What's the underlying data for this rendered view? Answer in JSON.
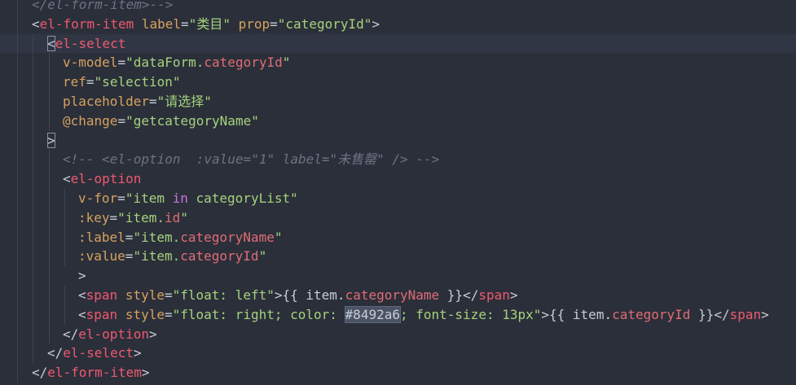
{
  "editor": {
    "lines": [
      {
        "indent": 1,
        "guides": [
          1
        ],
        "tokens": [
          {
            "t": "comment",
            "v": "</el-form-item>-->"
          }
        ]
      },
      {
        "indent": 1,
        "guides": [
          1
        ],
        "tokens": [
          {
            "t": "punct",
            "v": "<"
          },
          {
            "t": "tag",
            "v": "el-form-item"
          },
          {
            "t": "text",
            "v": " "
          },
          {
            "t": "attr",
            "v": "label"
          },
          {
            "t": "punct",
            "v": "="
          },
          {
            "t": "str",
            "v": "\"类目\""
          },
          {
            "t": "text",
            "v": " "
          },
          {
            "t": "attr",
            "v": "prop"
          },
          {
            "t": "punct",
            "v": "="
          },
          {
            "t": "str",
            "v": "\"categoryId\""
          },
          {
            "t": "punct",
            "v": ">"
          }
        ]
      },
      {
        "indent": 2,
        "guides": [
          1,
          2
        ],
        "active": true,
        "tokens": [
          {
            "t": "punct box",
            "v": "<"
          },
          {
            "t": "tag",
            "v": "el-select"
          }
        ]
      },
      {
        "indent": 3,
        "guides": [
          1,
          2,
          3
        ],
        "tokens": [
          {
            "t": "attr",
            "v": "v-model"
          },
          {
            "t": "punct",
            "v": "="
          },
          {
            "t": "str",
            "v": "\"dataForm."
          },
          {
            "t": "prop",
            "v": "categoryId"
          },
          {
            "t": "str",
            "v": "\""
          }
        ]
      },
      {
        "indent": 3,
        "guides": [
          1,
          2,
          3
        ],
        "tokens": [
          {
            "t": "attr",
            "v": "ref"
          },
          {
            "t": "punct",
            "v": "="
          },
          {
            "t": "str",
            "v": "\"selection\""
          }
        ]
      },
      {
        "indent": 3,
        "guides": [
          1,
          2,
          3
        ],
        "tokens": [
          {
            "t": "attr",
            "v": "placeholder"
          },
          {
            "t": "punct",
            "v": "="
          },
          {
            "t": "str",
            "v": "\"请选择\""
          }
        ]
      },
      {
        "indent": 3,
        "guides": [
          1,
          2,
          3
        ],
        "tokens": [
          {
            "t": "attr",
            "v": "@change"
          },
          {
            "t": "punct",
            "v": "="
          },
          {
            "t": "str",
            "v": "\"getcategoryName\""
          }
        ]
      },
      {
        "indent": 2,
        "guides": [
          1,
          2
        ],
        "tokens": [
          {
            "t": "punct box",
            "v": ">"
          }
        ]
      },
      {
        "indent": 3,
        "guides": [
          1,
          2,
          3
        ],
        "tokens": [
          {
            "t": "comment",
            "v": "<!-- <el-option  :value=\"1\" label=\"未售罄\" /> -->"
          }
        ]
      },
      {
        "indent": 3,
        "guides": [
          1,
          2,
          3
        ],
        "tokens": [
          {
            "t": "punct",
            "v": "<"
          },
          {
            "t": "tag",
            "v": "el-option"
          }
        ]
      },
      {
        "indent": 4,
        "guides": [
          1,
          2,
          3,
          4
        ],
        "tokens": [
          {
            "t": "attr",
            "v": "v-for"
          },
          {
            "t": "punct",
            "v": "="
          },
          {
            "t": "str",
            "v": "\"item "
          },
          {
            "t": "kw",
            "v": "in"
          },
          {
            "t": "str",
            "v": " categoryList\""
          }
        ]
      },
      {
        "indent": 4,
        "guides": [
          1,
          2,
          3,
          4
        ],
        "tokens": [
          {
            "t": "attr",
            "v": ":key"
          },
          {
            "t": "punct",
            "v": "="
          },
          {
            "t": "str",
            "v": "\"item."
          },
          {
            "t": "prop",
            "v": "id"
          },
          {
            "t": "str",
            "v": "\""
          }
        ]
      },
      {
        "indent": 4,
        "guides": [
          1,
          2,
          3,
          4
        ],
        "tokens": [
          {
            "t": "attr",
            "v": ":label"
          },
          {
            "t": "punct",
            "v": "="
          },
          {
            "t": "str",
            "v": "\"item."
          },
          {
            "t": "prop",
            "v": "categoryName"
          },
          {
            "t": "str",
            "v": "\""
          }
        ]
      },
      {
        "indent": 4,
        "guides": [
          1,
          2,
          3,
          4
        ],
        "tokens": [
          {
            "t": "attr",
            "v": ":value"
          },
          {
            "t": "punct",
            "v": "="
          },
          {
            "t": "str",
            "v": "\"item."
          },
          {
            "t": "prop",
            "v": "categoryId"
          },
          {
            "t": "str",
            "v": "\""
          }
        ]
      },
      {
        "indent": 4,
        "guides": [
          1,
          2,
          3
        ],
        "tokens": [
          {
            "t": "punct",
            "v": ">"
          }
        ]
      },
      {
        "indent": 4,
        "guides": [
          1,
          2,
          3,
          4
        ],
        "tokens": [
          {
            "t": "punct",
            "v": "<"
          },
          {
            "t": "tag",
            "v": "span"
          },
          {
            "t": "text",
            "v": " "
          },
          {
            "t": "attr",
            "v": "style"
          },
          {
            "t": "punct",
            "v": "="
          },
          {
            "t": "str",
            "v": "\"float: left\""
          },
          {
            "t": "punct",
            "v": ">"
          },
          {
            "t": "text",
            "v": "{{ item."
          },
          {
            "t": "prop",
            "v": "categoryName"
          },
          {
            "t": "text",
            "v": " }}"
          },
          {
            "t": "punct",
            "v": "</"
          },
          {
            "t": "tag",
            "v": "span"
          },
          {
            "t": "punct",
            "v": ">"
          }
        ]
      },
      {
        "indent": 4,
        "guides": [
          1,
          2,
          3,
          4
        ],
        "tokens": [
          {
            "t": "punct",
            "v": "<"
          },
          {
            "t": "tag",
            "v": "span"
          },
          {
            "t": "text",
            "v": " "
          },
          {
            "t": "attr",
            "v": "style"
          },
          {
            "t": "punct",
            "v": "="
          },
          {
            "t": "str",
            "v": "\"float: right; color: "
          },
          {
            "t": "hl",
            "v": "#8492a6"
          },
          {
            "t": "str",
            "v": "; font-size: 13px\""
          },
          {
            "t": "punct",
            "v": ">"
          },
          {
            "t": "text",
            "v": "{{ item."
          },
          {
            "t": "prop",
            "v": "categoryId"
          },
          {
            "t": "text",
            "v": " }}"
          },
          {
            "t": "punct",
            "v": "</"
          },
          {
            "t": "tag",
            "v": "span"
          },
          {
            "t": "punct",
            "v": ">"
          }
        ]
      },
      {
        "indent": 3,
        "guides": [
          1,
          2,
          3
        ],
        "tokens": [
          {
            "t": "punct",
            "v": "</"
          },
          {
            "t": "tag",
            "v": "el-option"
          },
          {
            "t": "punct",
            "v": ">"
          }
        ]
      },
      {
        "indent": 2,
        "guides": [
          1,
          2
        ],
        "tokens": [
          {
            "t": "punct",
            "v": "</"
          },
          {
            "t": "tag",
            "v": "el-select"
          },
          {
            "t": "punct",
            "v": ">"
          }
        ]
      },
      {
        "indent": 1,
        "guides": [
          1
        ],
        "tokens": [
          {
            "t": "punct",
            "v": "</"
          },
          {
            "t": "tag",
            "v": "el-form-item"
          },
          {
            "t": "punct",
            "v": ">"
          }
        ]
      }
    ]
  }
}
